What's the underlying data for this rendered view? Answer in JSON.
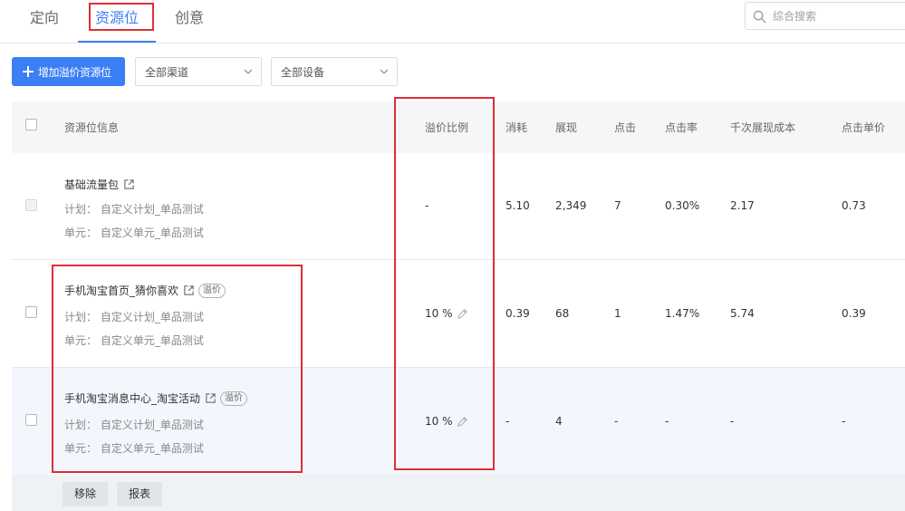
{
  "tabs": [
    {
      "label": "定向"
    },
    {
      "label": "资源位"
    },
    {
      "label": "创意"
    }
  ],
  "search": {
    "placeholder": "综合搜索"
  },
  "toolbar": {
    "add_label": "增加溢价资源位",
    "channel_select": "全部渠道",
    "device_select": "全部设备"
  },
  "table": {
    "headers": {
      "info": "资源位信息",
      "ratio": "溢价比例",
      "cost": "消耗",
      "impressions": "展现",
      "clicks": "点击",
      "ctr": "点击率",
      "cpm": "千次展现成本",
      "cpc": "点击单价"
    },
    "rows": [
      {
        "name": "基础流量包",
        "plan": "计划： 自定义计划_单品测试",
        "unit": "单元： 自定义单元_单品测试",
        "badge": "",
        "ratio": "-",
        "cost": "5.10",
        "impressions": "2,349",
        "clicks": "7",
        "ctr": "0.30%",
        "cpm": "2.17",
        "cpc": "0.73"
      },
      {
        "name": "手机淘宝首页_猜你喜欢",
        "plan": "计划： 自定义计划_单品测试",
        "unit": "单元： 自定义单元_单品测试",
        "badge": "溢价",
        "ratio": "10 %",
        "cost": "0.39",
        "impressions": "68",
        "clicks": "1",
        "ctr": "1.47%",
        "cpm": "5.74",
        "cpc": "0.39"
      },
      {
        "name": "手机淘宝消息中心_淘宝活动",
        "plan": "计划： 自定义计划_单品测试",
        "unit": "单元： 自定义单元_单品测试",
        "badge": "溢价",
        "ratio": "10 %",
        "cost": "-",
        "impressions": "4",
        "clicks": "-",
        "ctr": "-",
        "cpm": "-",
        "cpc": "-"
      }
    ]
  },
  "footer": {
    "remove_label": "移除",
    "report_label": "报表"
  },
  "colors": {
    "accent": "#3b7ff5",
    "highlight": "#e02e37",
    "selected_row": "#f3f7fd"
  },
  "icons": [
    "search-icon",
    "plus-icon",
    "chevron-down-icon",
    "external-link-icon",
    "pencil-icon"
  ]
}
